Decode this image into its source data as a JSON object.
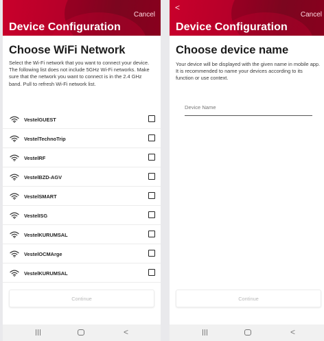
{
  "left_screen": {
    "header": {
      "cancel_label": "Cancel",
      "title": "Device Configuration"
    },
    "heading": "Choose WiFi Network",
    "description": "Select the Wi-Fi network that you want to connect your device. The following list does not include 5GHz Wi-Fi networks. Make sure that the network you want to connect is in the 2.4 GHz band. Pull to refresh Wi-Fi network list.",
    "networks": [
      {
        "name": "VestelGUEST",
        "checked": false
      },
      {
        "name": "VestelTechnoTrip",
        "checked": false
      },
      {
        "name": "VestelRF",
        "checked": false
      },
      {
        "name": "VestelBZD-AGV",
        "checked": false
      },
      {
        "name": "VestelSMART",
        "checked": false
      },
      {
        "name": "VestelISG",
        "checked": false
      },
      {
        "name": "VestelKURUMSAL",
        "checked": false
      },
      {
        "name": "VestelOCMArge",
        "checked": false
      },
      {
        "name": "VestelKURUMSAL",
        "checked": false
      }
    ],
    "continue_label": "Continue"
  },
  "right_screen": {
    "header": {
      "back_label": "<",
      "cancel_label": "Cancel",
      "title": "Device Configuration"
    },
    "heading": "Choose device name",
    "description": "Your device will be displayed with the given name in mobile app. It is recommended to name your devices according to its function or use context.",
    "device_name": {
      "value": "",
      "placeholder": "Device Name"
    },
    "continue_label": "Continue"
  },
  "nav_bar": {
    "back_glyph": "<"
  },
  "colors": {
    "brand": "#c9002b",
    "continue_text": "#b9b9b9"
  },
  "icons": [
    "wifi-icon",
    "checkbox-icon",
    "recent-apps-icon",
    "home-icon",
    "back-icon"
  ]
}
